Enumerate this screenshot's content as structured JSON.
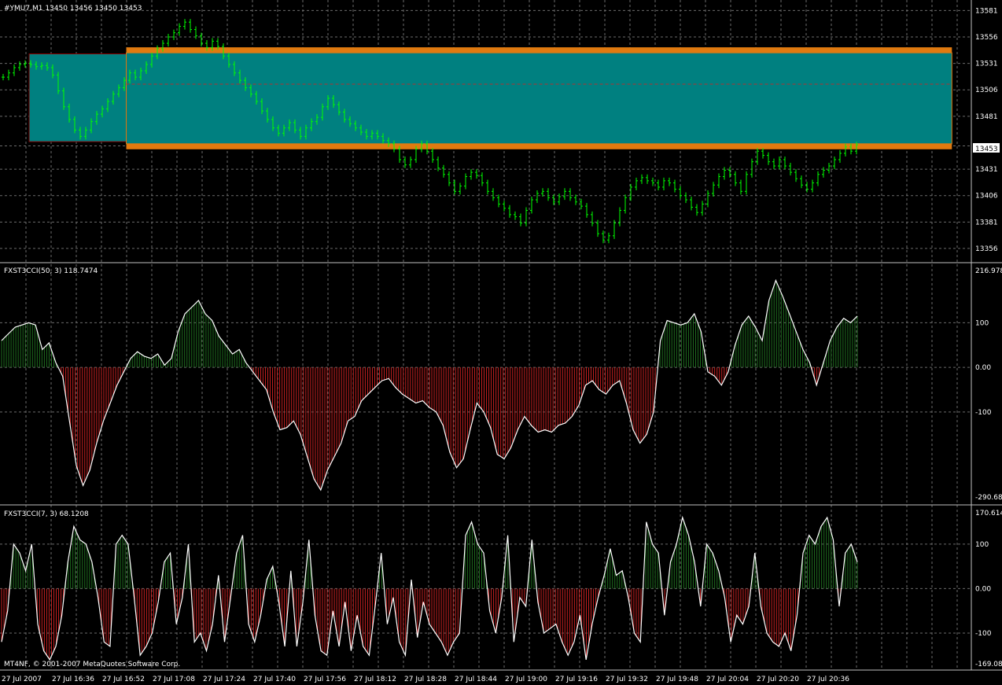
{
  "symbol_header": {
    "text": "#YMU7,M1  13450 13456 13450 13453",
    "current_price_tag": "13453"
  },
  "colors": {
    "background": "#000000",
    "grid": "#6b6b6b",
    "candle": "#00ff00",
    "zone_fill": "#008080",
    "zone_border": "#e07a10",
    "positive_hist": "#1f6e1f",
    "negative_hist": "#c82020",
    "cci_line": "#ffffff",
    "panel_separator": "#c0c0c0"
  },
  "chart_data": [
    {
      "type": "line",
      "name": "price",
      "ylim": [
        13350,
        13585
      ],
      "yticks": [
        "13581",
        "13556",
        "13531",
        "13506",
        "13481",
        "13453",
        "13431",
        "13406",
        "13381",
        "13356"
      ],
      "zones": [
        {
          "from_bar": 0.03,
          "to_bar": 0.13,
          "top": 13540,
          "bottom": 13457
        },
        {
          "from_bar": 0.13,
          "to_bar": 0.98,
          "top": 13541,
          "bottom": 13455
        }
      ],
      "series": [
        {
          "values": [
            13518,
            13522,
            13527,
            13530,
            13531,
            13530,
            13528,
            13529,
            13527,
            13520,
            13505,
            13490,
            13478,
            13468,
            13462,
            13468,
            13476,
            13483,
            13488,
            13495,
            13502,
            13508,
            13515,
            13522,
            13518,
            13524,
            13530,
            13538,
            13545,
            13550,
            13556,
            13560,
            13566,
            13570,
            13563,
            13557,
            13550,
            13546,
            13552,
            13547,
            13538,
            13530,
            13522,
            13515,
            13508,
            13502,
            13495,
            13486,
            13478,
            13470,
            13465,
            13470,
            13475,
            13468,
            13462,
            13470,
            13476,
            13480,
            13490,
            13498,
            13492,
            13485,
            13478,
            13474,
            13470,
            13466,
            13462,
            13465,
            13462,
            13458,
            13455,
            13450,
            13440,
            13435,
            13440,
            13450,
            13455,
            13448,
            13440,
            13432,
            13426,
            13418,
            13410,
            13415,
            13424,
            13428,
            13425,
            13418,
            13410,
            13404,
            13398,
            13394,
            13388,
            13386,
            13380,
            13392,
            13402,
            13408,
            13410,
            13404,
            13400,
            13405,
            13410,
            13404,
            13400,
            13396,
            13388,
            13380,
            13370,
            13364,
            13368,
            13380,
            13392,
            13404,
            13414,
            13420,
            13423,
            13420,
            13418,
            13414,
            13420,
            13418,
            13412,
            13406,
            13402,
            13395,
            13390,
            13398,
            13408,
            13416,
            13424,
            13430,
            13426,
            13418,
            13410,
            13426,
            13438,
            13448,
            13444,
            13438,
            13434,
            13440,
            13434,
            13428,
            13422,
            13416,
            13412,
            13418,
            13426,
            13430,
            13434,
            13440,
            13446,
            13452,
            13448,
            13454
          ]
        }
      ]
    },
    {
      "type": "area",
      "name": "FXST3CCI(50, 3) 118.7474",
      "ylim": [
        -290.683,
        216.9783
      ],
      "yticks": [
        "216.9783",
        "100",
        "0.00",
        "-100",
        "-290.683"
      ],
      "series": [
        {
          "values": [
            60,
            75,
            90,
            95,
            100,
            95,
            40,
            55,
            10,
            -20,
            -120,
            -220,
            -265,
            -230,
            -170,
            -120,
            -80,
            -40,
            -10,
            20,
            35,
            25,
            20,
            30,
            5,
            20,
            80,
            120,
            135,
            150,
            120,
            105,
            70,
            50,
            30,
            40,
            10,
            -10,
            -30,
            -50,
            -100,
            -140,
            -135,
            -120,
            -150,
            -200,
            -250,
            -275,
            -230,
            -200,
            -170,
            -120,
            -110,
            -75,
            -60,
            -45,
            -30,
            -25,
            -45,
            -60,
            -70,
            -80,
            -75,
            -90,
            -100,
            -130,
            -190,
            -225,
            -205,
            -140,
            -80,
            -100,
            -135,
            -195,
            -205,
            -180,
            -140,
            -110,
            -130,
            -145,
            -140,
            -145,
            -130,
            -125,
            -110,
            -85,
            -40,
            -30,
            -50,
            -60,
            -40,
            -30,
            -80,
            -140,
            -170,
            -150,
            -100,
            60,
            105,
            100,
            95,
            100,
            120,
            80,
            -10,
            -20,
            -40,
            -10,
            50,
            95,
            115,
            90,
            60,
            150,
            195,
            160,
            120,
            80,
            40,
            10,
            -40,
            10,
            60,
            90,
            110,
            100,
            115
          ]
        }
      ]
    },
    {
      "type": "area",
      "name": "FXST3CCI(7, 3) 68.1208",
      "ylim": [
        -169.084,
        170.6142
      ],
      "yticks": [
        "170.6142",
        "100",
        "0.00",
        "-100",
        "-169.084"
      ],
      "series": [
        {
          "values": [
            -120,
            -50,
            100,
            80,
            40,
            100,
            -80,
            -140,
            -160,
            -130,
            -60,
            60,
            140,
            110,
            100,
            60,
            -20,
            -120,
            -130,
            100,
            120,
            100,
            -20,
            -150,
            -130,
            -100,
            -30,
            60,
            80,
            -80,
            -20,
            100,
            -120,
            -100,
            -140,
            -80,
            30,
            -120,
            -20,
            80,
            120,
            -80,
            -120,
            -60,
            20,
            50,
            -30,
            -130,
            40,
            -130,
            -30,
            110,
            -60,
            -140,
            -150,
            -50,
            -130,
            -30,
            -140,
            -60,
            -130,
            -150,
            -40,
            80,
            -80,
            -20,
            -120,
            -150,
            20,
            -110,
            -30,
            -80,
            -100,
            -120,
            -150,
            -120,
            -100,
            120,
            150,
            100,
            80,
            -50,
            -100,
            -20,
            120,
            -120,
            -20,
            -40,
            110,
            -30,
            -100,
            -90,
            -80,
            -120,
            -150,
            -120,
            -60,
            -160,
            -80,
            -20,
            30,
            90,
            30,
            40,
            -20,
            -100,
            -120,
            150,
            100,
            80,
            -60,
            60,
            100,
            160,
            120,
            60,
            -40,
            100,
            80,
            40,
            -20,
            -120,
            -60,
            -80,
            -40,
            80,
            -40,
            -100,
            -120,
            -130,
            -100,
            -140,
            -60,
            80,
            120,
            100,
            140,
            160,
            110,
            -40,
            80,
            100,
            60
          ]
        }
      ]
    }
  ],
  "time_axis": [
    "27 Jul 2007",
    "27 Jul 16:36",
    "27 Jul 16:52",
    "27 Jul 17:08",
    "27 Jul 17:24",
    "27 Jul 17:40",
    "27 Jul 17:56",
    "27 Jul 18:12",
    "27 Jul 18:28",
    "27 Jul 18:44",
    "27 Jul 19:00",
    "27 Jul 19:16",
    "27 Jul 19:32",
    "27 Jul 19:48",
    "27 Jul 20:04",
    "27 Jul 20:20",
    "27 Jul 20:36"
  ],
  "copyright": "MT4NF, © 2001-2007 MetaQuotes Software Corp."
}
